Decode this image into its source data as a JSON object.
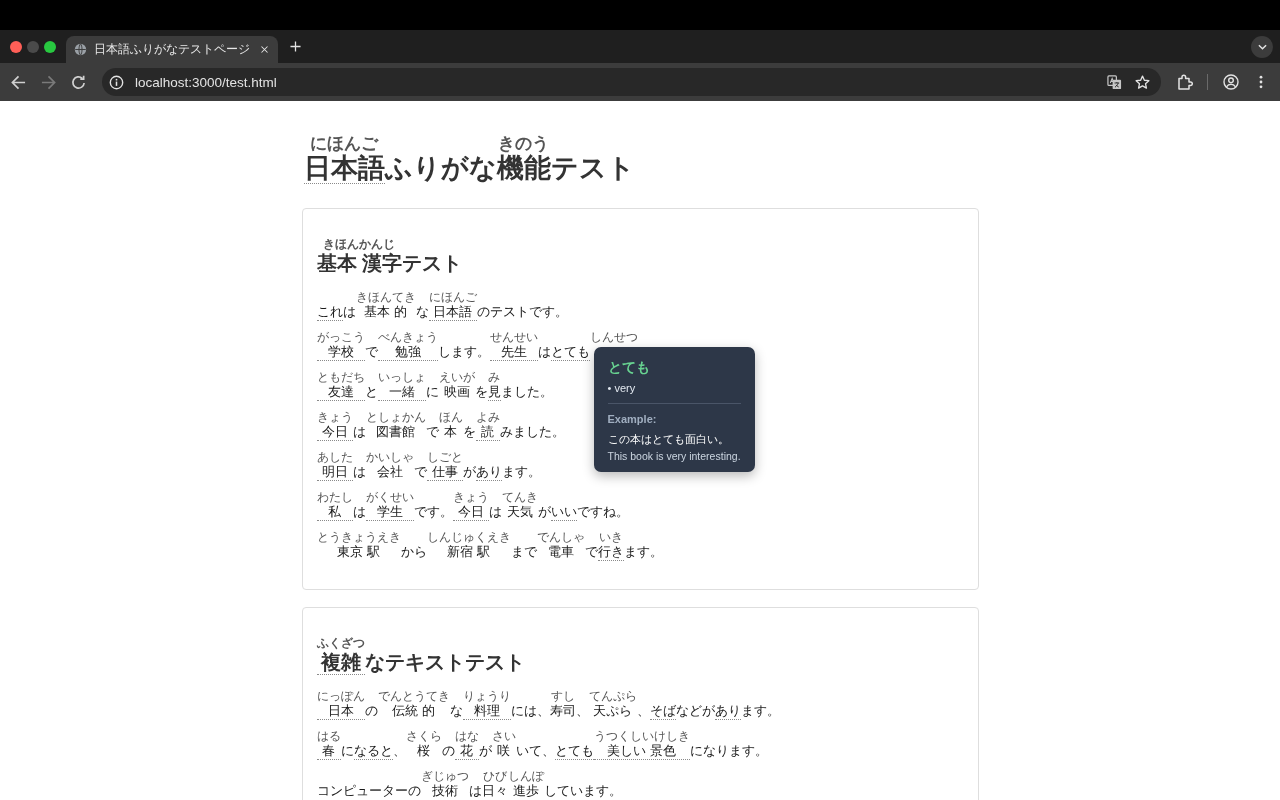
{
  "browser": {
    "tabs": [
      {
        "title": "日本語ふりがなテストページ",
        "selected": true
      }
    ],
    "nav": [
      {
        "kind": "back",
        "disabled": false
      },
      {
        "kind": "forward",
        "disabled": true
      },
      {
        "kind": "reload",
        "disabled": false
      }
    ],
    "address_bar": {
      "url": "localhost:3000/test.html"
    }
  },
  "page": {
    "title": [
      {
        "text": "日本語",
        "ruby": "にほんご",
        "underlined": true
      },
      {
        "text": "ふりがな",
        "underlined": false
      },
      {
        "text": "機能",
        "ruby": "きのう",
        "underlined": false
      },
      {
        "text": "テスト",
        "underlined": false
      }
    ],
    "sections": [
      {
        "heading": [
          {
            "text": "基本 漢字",
            "ruby": "きほんかんじ",
            "underlined": false
          },
          {
            "text": "テスト",
            "underlined": false
          }
        ],
        "sentences": [
          [
            {
              "text": "これ",
              "underlined": true
            },
            {
              "text": "は",
              "underlined": false
            },
            {
              "text": "基本 的",
              "ruby": "きほんてき",
              "underlined": false
            },
            {
              "text": "な",
              "underlined": false
            },
            {
              "text": "日本語",
              "ruby": "にほんご",
              "underlined": true
            },
            {
              "text": "のテストです。",
              "underlined": false
            }
          ],
          [
            {
              "text": "学校",
              "ruby": "がっこう",
              "underlined": true
            },
            {
              "text": "で",
              "underlined": false
            },
            {
              "text": "勉強",
              "ruby": "べんきょう",
              "underlined": true
            },
            {
              "text": "します。",
              "underlined": false
            },
            {
              "text": "先生",
              "ruby": "せんせい",
              "underlined": true
            },
            {
              "text": "は",
              "underlined": false
            },
            {
              "text": "とても",
              "underlined": true,
              "tooltip": {
                "word": "とても",
                "definitions": [
                  "• very"
                ],
                "example_label": "Example:",
                "example": "この本はとても面白い。",
                "translation": "This book is very interesting."
              }
            },
            {
              "ruby": "しんせつ"
            }
          ],
          [
            {
              "text": "友達",
              "ruby": "ともだち",
              "underlined": true
            },
            {
              "text": "と",
              "underlined": false
            },
            {
              "text": "一緒",
              "ruby": "いっしょ",
              "underlined": true
            },
            {
              "text": "に",
              "underlined": false
            },
            {
              "text": "映画",
              "ruby": "えいが",
              "underlined": false
            },
            {
              "text": "を",
              "underlined": false
            },
            {
              "text": "見",
              "ruby": "み",
              "underlined": true
            },
            {
              "text": "ました。",
              "underlined": false
            }
          ],
          [
            {
              "text": "今日",
              "ruby": "きょう",
              "underlined": true
            },
            {
              "text": "は",
              "underlined": false
            },
            {
              "text": "図書館",
              "ruby": "としょかん",
              "underlined": false
            },
            {
              "text": "で",
              "underlined": false
            },
            {
              "text": "本",
              "ruby": "ほん",
              "underlined": false
            },
            {
              "text": "を",
              "underlined": false
            },
            {
              "text": "読",
              "ruby": "よみ",
              "underlined": true
            },
            {
              "text": "みました。",
              "underlined": false
            }
          ],
          [
            {
              "text": "明日",
              "ruby": "あした",
              "underlined": true
            },
            {
              "text": "は",
              "underlined": false
            },
            {
              "text": "会社",
              "ruby": "かいしゃ",
              "underlined": false
            },
            {
              "text": "で",
              "underlined": false
            },
            {
              "text": "仕事",
              "ruby": "しごと",
              "underlined": true
            },
            {
              "text": "が",
              "underlined": false
            },
            {
              "text": "あり",
              "underlined": true
            },
            {
              "text": "ます。",
              "underlined": false
            }
          ],
          [
            {
              "text": "私",
              "ruby": "わたし",
              "underlined": true
            },
            {
              "text": "は",
              "underlined": false
            },
            {
              "text": "学生",
              "ruby": "がくせい",
              "underlined": true
            },
            {
              "text": "です。",
              "underlined": false
            },
            {
              "text": "今日",
              "ruby": "きょう",
              "underlined": true
            },
            {
              "text": "は",
              "underlined": false
            },
            {
              "text": "天気",
              "ruby": "てんき",
              "underlined": false
            },
            {
              "text": "が",
              "underlined": false
            },
            {
              "text": "いい",
              "underlined": true
            },
            {
              "text": "ですね。",
              "underlined": false
            }
          ],
          [
            {
              "text": "東京 駅",
              "ruby": "とうきょうえき",
              "underlined": false
            },
            {
              "text": "から",
              "underlined": false
            },
            {
              "text": "新宿 駅",
              "ruby": "しんじゅくえき",
              "underlined": false
            },
            {
              "text": "まで",
              "underlined": false
            },
            {
              "text": "電車",
              "ruby": "でんしゃ",
              "underlined": false
            },
            {
              "text": "で",
              "underlined": false
            },
            {
              "text": "行き",
              "ruby": "いき",
              "underlined": true
            },
            {
              "text": "ます。",
              "underlined": false
            }
          ]
        ]
      },
      {
        "heading": [
          {
            "text": "複雑",
            "ruby": "ふくざつ",
            "underlined": true
          },
          {
            "text": "なテキストテスト",
            "underlined": false
          }
        ],
        "sentences": [
          [
            {
              "text": "日本",
              "ruby": "にっぽん",
              "underlined": true
            },
            {
              "text": "の",
              "underlined": false
            },
            {
              "text": "伝統 的",
              "ruby": "でんとうてき",
              "underlined": false
            },
            {
              "text": "な",
              "underlined": false
            },
            {
              "text": "料理",
              "ruby": "りょうり",
              "underlined": true
            },
            {
              "text": "には、",
              "underlined": false
            },
            {
              "text": "寿司",
              "ruby": "すし",
              "underlined": false
            },
            {
              "text": "、",
              "underlined": false
            },
            {
              "text": "天ぷら",
              "ruby": "てんぷら",
              "underlined": false
            },
            {
              "text": "、",
              "underlined": false
            },
            {
              "text": "そば",
              "underlined": true
            },
            {
              "text": "などが",
              "underlined": false
            },
            {
              "text": "あり",
              "underlined": true
            },
            {
              "text": "ます。",
              "underlined": false
            }
          ],
          [
            {
              "text": "春",
              "ruby": "はる",
              "underlined": true
            },
            {
              "text": "に",
              "underlined": false
            },
            {
              "text": "なると",
              "underlined": true
            },
            {
              "text": "、",
              "underlined": false
            },
            {
              "text": "桜",
              "ruby": "さくら",
              "underlined": false
            },
            {
              "text": "の",
              "underlined": false
            },
            {
              "text": "花",
              "ruby": "はな",
              "underlined": true
            },
            {
              "text": "が",
              "underlined": false
            },
            {
              "text": "咲",
              "ruby": "さい",
              "underlined": false
            },
            {
              "text": "いて、",
              "underlined": false
            },
            {
              "text": "とても",
              "underlined": true
            },
            {
              "text": "美しい 景色",
              "ruby": "うつくしいけしき",
              "underlined": true
            },
            {
              "text": "になります。",
              "underlined": false
            }
          ],
          [
            {
              "text": "コンピューターの",
              "underlined": false
            },
            {
              "text": "技術",
              "ruby": "ぎじゅつ",
              "underlined": false
            },
            {
              "text": "は",
              "underlined": false
            },
            {
              "text": "日々",
              "ruby": "ひび",
              "underlined": false
            },
            {
              "text": "進歩",
              "ruby": "しんぽ",
              "underlined": false
            },
            {
              "text": "しています。",
              "underlined": false
            }
          ]
        ]
      }
    ]
  }
}
